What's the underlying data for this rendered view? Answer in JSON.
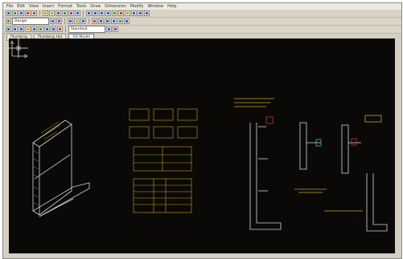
{
  "menu": [
    "File",
    "Edit",
    "View",
    "Insert",
    "Format",
    "Tools",
    "Draw",
    "Dimension",
    "Modify",
    "Window",
    "Help"
  ],
  "toolbar": {
    "layer_combo": "Design",
    "textstyle_combo": "Standard"
  },
  "tabs": [
    "Plumbing",
    "Plumbing Hot",
    "AD Model"
  ],
  "active_tab_index": 2,
  "colors": {
    "canvas_bg": "#0a0908",
    "drawing_white": "#d8d8d8",
    "drawing_yellow": "#c8a21d",
    "drawing_cyan": "#3ab8c8",
    "drawing_red": "#c23a2b"
  },
  "icons": [
    "save-icon",
    "open-icon",
    "print-icon",
    "undo-icon",
    "redo-icon",
    "zoom-icon",
    "pan-icon",
    "layer-icon",
    "line-icon",
    "circle-icon",
    "arc-icon",
    "rect-icon",
    "hatch-icon",
    "text-icon",
    "dim-icon"
  ]
}
